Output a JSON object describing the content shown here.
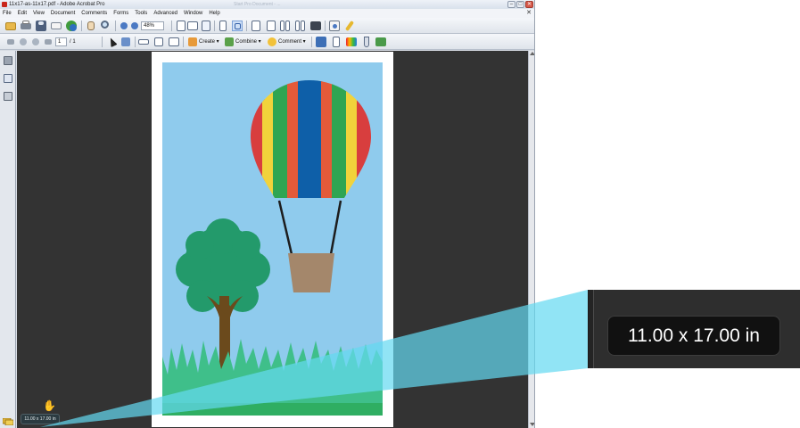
{
  "window": {
    "title": "11x17-as-11x17.pdf - Adobe Acrobat Pro",
    "background_title": "Start Pro Document - ...",
    "controls": {
      "minimize": "–",
      "maximize": "□",
      "close": "✕"
    }
  },
  "menubar": {
    "items": [
      "File",
      "Edit",
      "View",
      "Document",
      "Comments",
      "Forms",
      "Tools",
      "Advanced",
      "Window",
      "Help"
    ],
    "close_doc": "✕"
  },
  "toolbar": {
    "zoom_value": "48%",
    "page_current": "1",
    "page_total": "/ 1",
    "create_label": "Create",
    "combine_label": "Combine",
    "comment_label": "Comment"
  },
  "status": {
    "page_size": "11.00 x 17.00 in"
  },
  "magnifier": {
    "page_size": "11.00 x 17.00 in"
  },
  "colors": {
    "doc_background": "#333333",
    "sky": "#8fcbed",
    "grass": "#4cc9b0",
    "magnifier_beam": "#5ad7f0"
  },
  "icons": [
    "folder-open-icon",
    "print-icon",
    "save-icon",
    "email-icon",
    "share-icon",
    "hand-icon",
    "zoom-icon",
    "zoom-out-icon",
    "zoom-in-icon",
    "fit-page-icon",
    "select-icon",
    "pages-panel-icon",
    "bookmarks-icon",
    "signatures-icon",
    "hand-cursor-icon"
  ]
}
